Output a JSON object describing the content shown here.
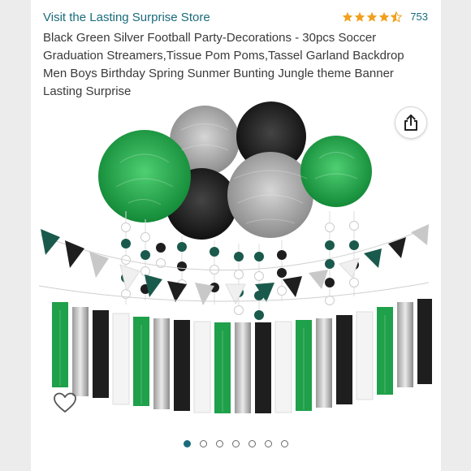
{
  "store": {
    "link_label": "Visit the Lasting Surprise Store"
  },
  "rating": {
    "stars": 4.5,
    "count": "753",
    "star_color": "#f0a01e"
  },
  "product": {
    "title": "Black Green Silver Football Party-Decorations - 30pcs Soccer Graduation Streamers,Tissue Pom Poms,Tassel Garland Backdrop Men Boys Birthday Spring Sunmer Bunting Jungle theme Banner Lasting Surprise"
  },
  "actions": {
    "share_icon": "share-icon",
    "wishlist_icon": "heart-icon"
  },
  "carousel": {
    "total": 7,
    "active_index": 0
  },
  "colors": {
    "accent": "#1a6b7c",
    "green": "#1fa04a",
    "black": "#1e1e1e",
    "silver": "#a9a9a9"
  }
}
